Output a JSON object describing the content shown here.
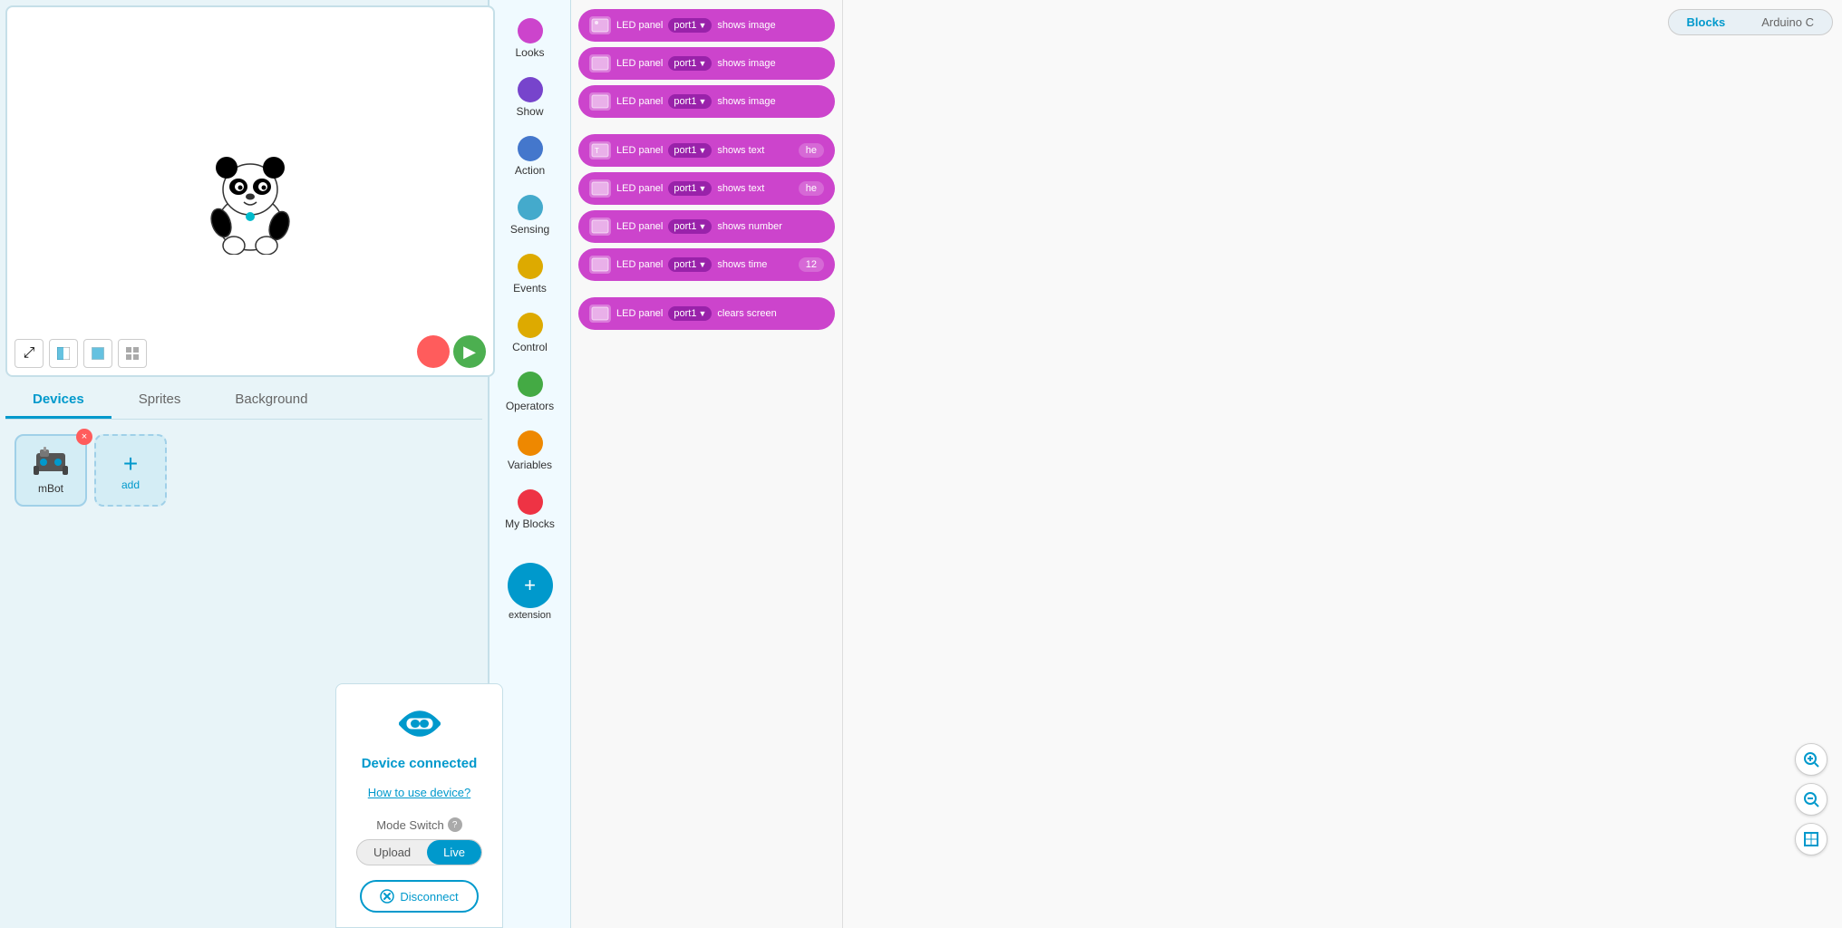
{
  "tabs": {
    "devices_label": "Devices",
    "sprites_label": "Sprites",
    "background_label": "Background"
  },
  "workspace_tabs": {
    "blocks_label": "Blocks",
    "arduino_label": "Arduino C"
  },
  "devices": [
    {
      "name": "mBot",
      "has_close": true
    },
    {
      "name": "add",
      "is_add": true
    }
  ],
  "device_panel": {
    "connected_text": "Device connected",
    "how_to_text": "How to use device?",
    "mode_switch_label": "Mode Switch",
    "upload_btn": "Upload",
    "live_btn": "Live",
    "disconnect_btn": "Disconnect"
  },
  "categories": [
    {
      "id": "looks",
      "label": "Looks",
      "color": "#cc44cc"
    },
    {
      "id": "show",
      "label": "Show",
      "color": "#7744cc"
    },
    {
      "id": "action",
      "label": "Action",
      "color": "#4477cc"
    },
    {
      "id": "sensing",
      "label": "Sensing",
      "color": "#44aacc"
    },
    {
      "id": "events",
      "label": "Events",
      "color": "#ddaa00"
    },
    {
      "id": "control",
      "label": "Control",
      "color": "#ddaa00"
    },
    {
      "id": "operators",
      "label": "Operators",
      "color": "#44aa44"
    },
    {
      "id": "variables",
      "label": "Variables",
      "color": "#ee8800"
    },
    {
      "id": "myblocks",
      "label": "My Blocks",
      "color": "#ee3344"
    }
  ],
  "blocks": [
    {
      "id": "b1",
      "port": "port1",
      "action": "shows image",
      "spacer": false
    },
    {
      "id": "b2",
      "port": "port1",
      "action": "shows image",
      "spacer": false
    },
    {
      "id": "b3",
      "port": "port1",
      "action": "shows image",
      "spacer": false
    },
    {
      "id": "b4",
      "port": "port1",
      "action": "shows text",
      "value": "he",
      "spacer": true
    },
    {
      "id": "b5",
      "port": "port1",
      "action": "shows text",
      "value": "he",
      "spacer": false
    },
    {
      "id": "b6",
      "port": "port1",
      "action": "shows number",
      "spacer": false
    },
    {
      "id": "b7",
      "port": "port1",
      "action": "shows time",
      "value": "12",
      "spacer": false
    },
    {
      "id": "b8",
      "port": "port1",
      "action": "clears screen",
      "spacer": true
    }
  ],
  "stage_controls": {
    "expand_icon": "⤢",
    "half_icon": "▪",
    "full_icon": "▦",
    "grid_icon": "⊞"
  }
}
